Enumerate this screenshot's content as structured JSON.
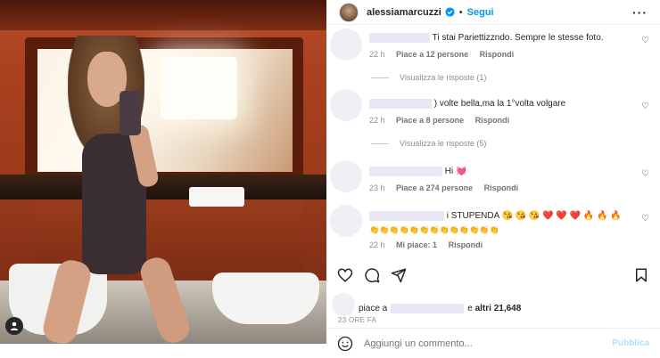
{
  "header": {
    "username": "alessiamarcuzzi",
    "separator": "•",
    "follow_label": "Segui",
    "more": "···"
  },
  "comments": [
    {
      "text": "Ti stai Pariettizzndo. Sempre le stesse foto.",
      "time": "22 h",
      "likes": "Piace a 12 persone",
      "reply": "Rispondi",
      "view_replies": "Visualizza le risposte (1)"
    },
    {
      "text": ") volte bella,ma la 1°volta volgare",
      "time": "22 h",
      "likes": "Piace a 8 persone",
      "reply": "Rispondi",
      "view_replies": "Visualizza le risposte (5)"
    },
    {
      "text": "Hi 💓",
      "time": "23 h",
      "likes": "Piace a 274 persone",
      "reply": "Rispondi"
    },
    {
      "text": "i STUPENDA 😘 😘 😘 ❤️ ❤️ ❤️ 🔥 🔥 🔥",
      "text2": "👏👏👏👏👏👏👏👏👏👏👏👏👏",
      "time": "22 h",
      "likes": "Mi piace: 1",
      "reply": "Rispondi"
    }
  ],
  "likes_line": {
    "prefix": "piace a",
    "connector": "e",
    "others": "altri 21,648"
  },
  "timestamp": "23 ORE FA",
  "add_comment": {
    "placeholder": "Aggiungi un commento...",
    "publish_label": "Pubblica"
  },
  "colors": {
    "accent": "#0095f6",
    "publish_disabled": "#b2dffc",
    "redaction": "#e8e8f4"
  }
}
